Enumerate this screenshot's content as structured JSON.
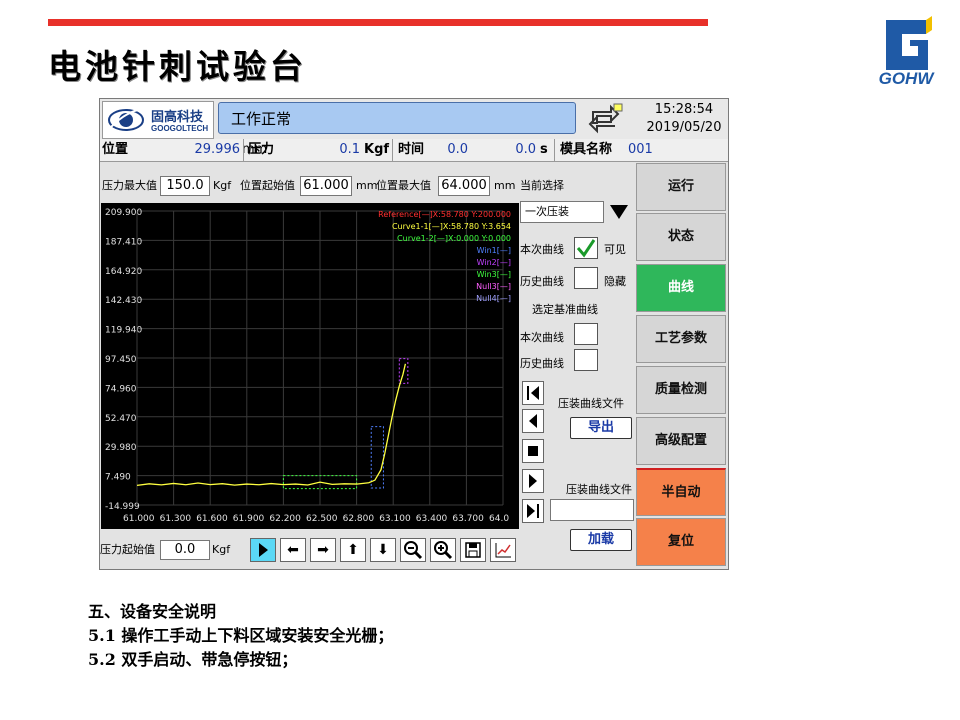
{
  "slide": {
    "title": "电池针刺试验台",
    "logo_text": "GOHW",
    "notes": [
      "五、设备安全说明",
      "5.1 操作工手动上下料区域安装安全光栅；",
      "5.2 双手启动、带急停按钮；"
    ]
  },
  "hmi": {
    "brand_cn": "固高科技",
    "brand_en": "GOOGOLTECH",
    "status": "工作正常",
    "time": "15:28:54",
    "date": "2019/05/20",
    "info": {
      "pos_label": "位置",
      "pos_value": "29.996",
      "pos_unit": "mm",
      "force_label": "压力",
      "force_value": "0.1",
      "force_unit": "Kgf",
      "time_label": "时间",
      "time_value": "0.0",
      "time_value2": "0.0",
      "time_unit": "s",
      "mold_label": "模具名称",
      "mold_value": "001"
    },
    "params": {
      "max_force_label": "压力最大值",
      "max_force_value": "150.0",
      "max_force_unit": "Kgf",
      "pos_start_label": "位置起始值",
      "pos_start_value": "61.000",
      "pos_start_unit": "mm",
      "pos_max_label": "位置最大值",
      "pos_max_value": "64.000",
      "pos_max_unit": "mm",
      "current_select_label": "当前选择"
    },
    "right": {
      "select_value": "一次压装",
      "this_curve": "本次曲线",
      "visible": "可见",
      "history_curve": "历史曲线",
      "hide": "隐藏",
      "select_base": "选定基准曲线",
      "this_curve2": "本次曲线",
      "history_curve2": "历史曲线",
      "press_file": "压装曲线文件",
      "export": "导出",
      "press_file2": "压装曲线文件",
      "load": "加载"
    },
    "nav": [
      "运行",
      "状态",
      "曲线",
      "工艺参数",
      "质量检测",
      "高级配置",
      "半自动",
      "复位"
    ],
    "bottom": {
      "force_start_label": "压力起始值",
      "force_start_value": "0.0",
      "force_start_unit": "Kgf"
    }
  },
  "chart_data": {
    "type": "line",
    "y_ticks": [
      "209.900",
      "187.410",
      "164.920",
      "142.430",
      "119.940",
      "97.450",
      "74.960",
      "52.470",
      "29.980",
      "7.490",
      "-14.999"
    ],
    "x_ticks": [
      "61.000",
      "61.300",
      "61.600",
      "61.900",
      "62.200",
      "62.500",
      "62.800",
      "63.100",
      "63.400",
      "63.700",
      "64.0"
    ],
    "xlim": [
      61.0,
      64.0
    ],
    "ylim": [
      -14.999,
      209.9
    ],
    "legend": [
      {
        "text": "Reference[—]X:58.780 Y:200.000",
        "color": "#ff3030"
      },
      {
        "text": "Curve1-1[—]X:58.780 Y:3.654",
        "color": "#ffff40"
      },
      {
        "text": "Curve1-2[—]X:0.000 Y:0.000",
        "color": "#40ff40"
      },
      {
        "text": "Win1[—]",
        "color": "#5080ff"
      },
      {
        "text": "Win2[—]",
        "color": "#c040ff"
      },
      {
        "text": "Win3[—]",
        "color": "#40ff40"
      },
      {
        "text": "Null3[—]",
        "color": "#ff60ff"
      },
      {
        "text": "Null4[—]",
        "color": "#a0a0ff"
      }
    ],
    "series": [
      {
        "color": "#ffff40",
        "x": [
          61.0,
          61.1,
          61.2,
          61.3,
          61.4,
          61.5,
          61.6,
          61.7,
          61.8,
          61.9,
          62.0,
          62.1,
          62.2,
          62.3,
          62.4,
          62.5,
          62.6,
          62.7,
          62.8,
          62.9,
          62.95,
          63.0,
          63.03,
          63.06,
          63.09,
          63.12,
          63.15,
          63.18,
          63.2
        ],
        "y": [
          0.0,
          1.2,
          0.4,
          1.5,
          0.5,
          1.8,
          0.6,
          1.3,
          0.2,
          1.0,
          0.5,
          1.4,
          0.6,
          1.0,
          0.3,
          2.5,
          0.8,
          1.2,
          1.0,
          2.0,
          4.0,
          12.0,
          24.0,
          38.0,
          52.0,
          65.0,
          76.0,
          85.0,
          93.0
        ]
      }
    ],
    "windows": [
      {
        "color": "#40ff40",
        "x": [
          62.2,
          62.8
        ],
        "y": [
          -2.5,
          7.5
        ]
      },
      {
        "color": "#5080ff",
        "x": [
          62.92,
          63.02
        ],
        "y": [
          -2.0,
          45.0
        ]
      },
      {
        "color": "#c040ff",
        "x": [
          63.15,
          63.22
        ],
        "y": [
          78.0,
          97.0
        ]
      }
    ]
  }
}
